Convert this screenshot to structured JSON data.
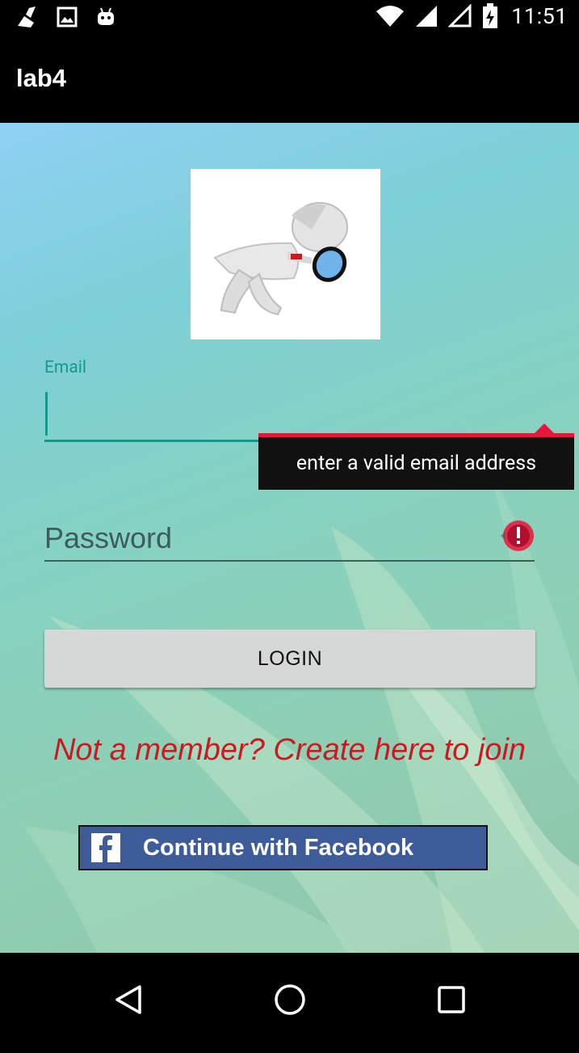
{
  "status_bar": {
    "time": "11:51",
    "icons": [
      "cleaner-icon",
      "image-icon",
      "android-icon",
      "wifi-icon",
      "signal-icon",
      "signal-empty-icon",
      "battery-charging-icon"
    ]
  },
  "app_bar": {
    "title": "lab4"
  },
  "form": {
    "email_label": "Email",
    "email_value": "",
    "email_error": "enter a valid email address",
    "password_placeholder": "Password",
    "password_value": "",
    "login_label": "LOGIN",
    "signup_text": "Not a member? Create here to join",
    "facebook_label": "Continue with Facebook"
  },
  "colors": {
    "accent": "#139a8c",
    "error": "#e8153a",
    "signup_link": "#c81b1f",
    "facebook": "#3f5c9a",
    "login_button": "#d6d7d7"
  },
  "nav_bar": {
    "icons": [
      "back-icon",
      "home-icon",
      "recents-icon"
    ]
  }
}
